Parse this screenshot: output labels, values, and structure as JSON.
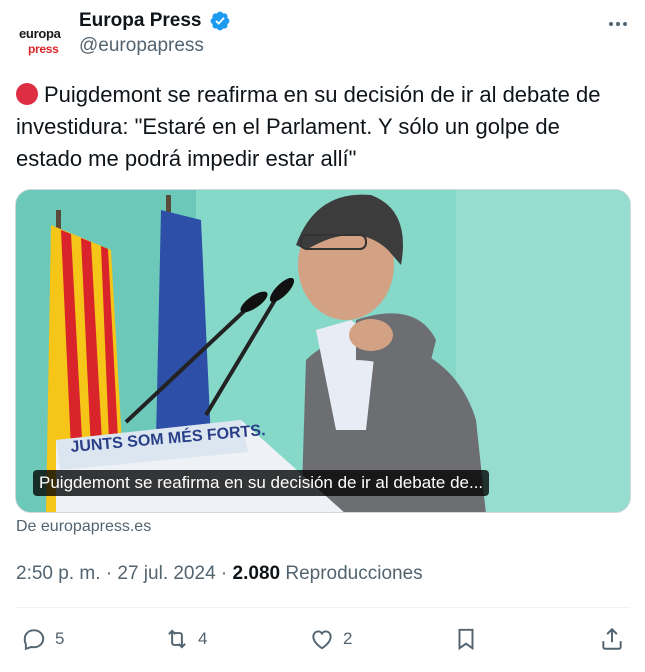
{
  "account": {
    "logo_line1": "europa",
    "logo_line2": "press",
    "display_name": "Europa Press",
    "handle": "@europapress",
    "verified_icon": "verified-badge-icon"
  },
  "tweet": {
    "text": "Puigdemont se reafirma en su decisión de ir al debate de investidura: \"Estaré en el Parlament. Y sólo un golpe de estado me podrá impedir estar allí\"",
    "emoji": "red-circle",
    "media_caption": "Puigdemont se reafirma en su decisión de ir al debate de...",
    "podium_text": "JUNTS SOM MÉS FORTS.",
    "source": "De europapress.es"
  },
  "meta": {
    "time": "2:50 p. m.",
    "separator": "·",
    "date": "27 jul. 2024",
    "views_count": "2.080",
    "views_label": "Reproducciones"
  },
  "actions": {
    "replies": "5",
    "reposts": "4",
    "likes": "2"
  },
  "colors": {
    "text": "#0f1419",
    "secondary": "#536471",
    "verified": "#1d9bf0",
    "brand_red": "#d9262a"
  }
}
